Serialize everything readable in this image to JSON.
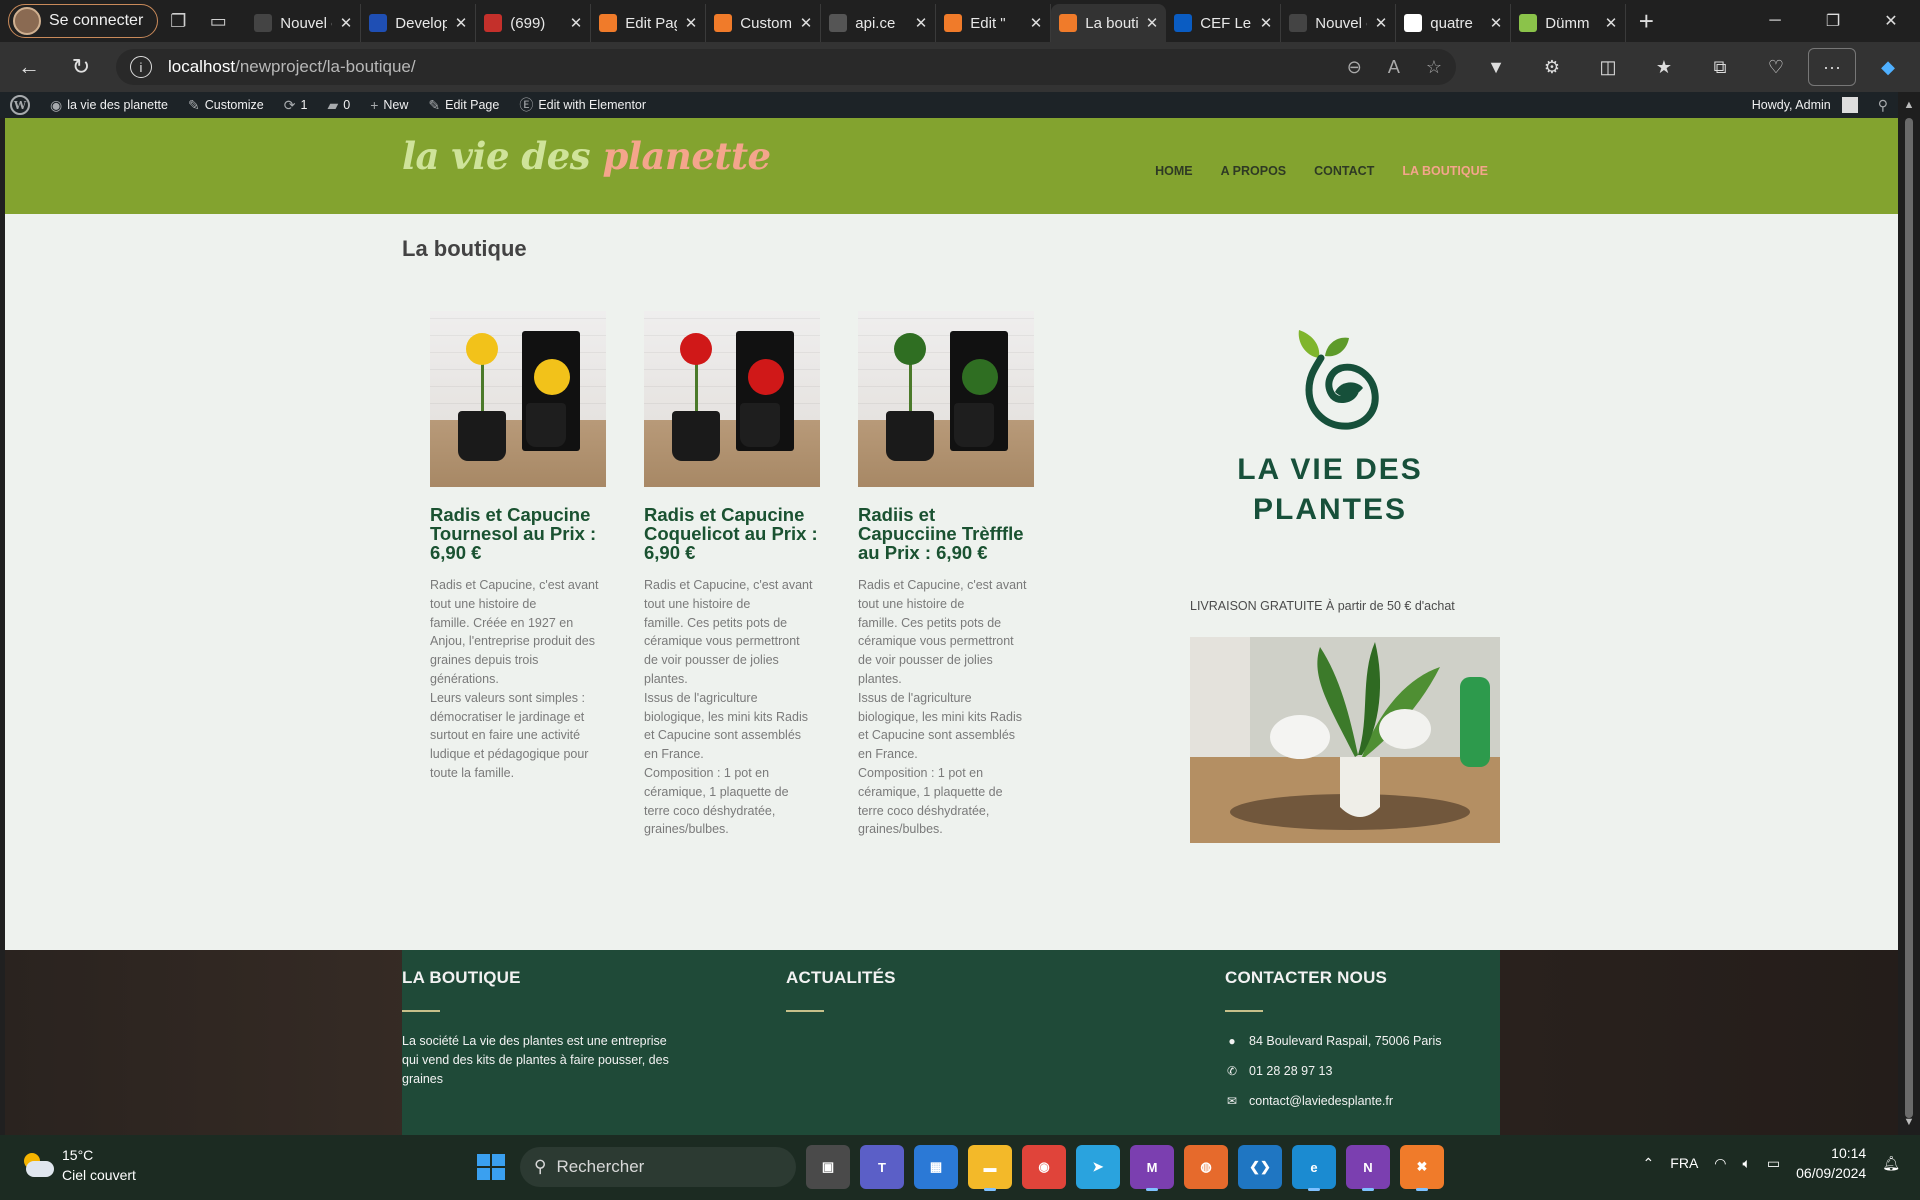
{
  "browser": {
    "profile_label": "Se connecter",
    "tabs": [
      {
        "title": "Nouvel onglet",
        "color": "#444444"
      },
      {
        "title": "Developer",
        "color": "#1f4fb4"
      },
      {
        "title": "(699)",
        "color": "#c4302b"
      },
      {
        "title": "Edit Page",
        "color": "#f07b2a"
      },
      {
        "title": "Customize",
        "color": "#f07b2a"
      },
      {
        "title": "api.ce",
        "color": "#555555"
      },
      {
        "title": "Edit \"",
        "color": "#f07b2a"
      },
      {
        "title": "La boutique",
        "color": "#f07b2a",
        "active": true
      },
      {
        "title": "CEF Le",
        "color": "#0a5cc2"
      },
      {
        "title": "Nouvel onglet",
        "color": "#444444"
      },
      {
        "title": "quatre",
        "color": "#ffffff"
      },
      {
        "title": "Dümm",
        "color": "#8bc34a"
      }
    ],
    "url_host": "localhost",
    "url_path": "/newproject/la-boutique/"
  },
  "wpbar": {
    "site": "la vie des planette",
    "customize": "Customize",
    "updates": "1",
    "comments": "0",
    "new": "New",
    "edit_page": "Edit Page",
    "elementor": "Edit with Elementor",
    "howdy": "Howdy, Admin"
  },
  "site": {
    "logo_part1": "la vie des",
    "logo_part2": "planette",
    "nav": [
      "HOME",
      "A PROPOS",
      "CONTACT",
      "LA BOUTIQUE"
    ],
    "page_title": "La boutique",
    "brand_line1": "LA VIE DES",
    "brand_line2": "PLANTES",
    "shipping": "LIVRAISON GRATUITE À partir de 50 € d'achat",
    "colors": {
      "header": "#83a32f",
      "accent": "#f4a58c",
      "product_title": "#1a5231",
      "footer": "#1f4a38"
    }
  },
  "products": [
    {
      "title": "Radis et Capucine Tournesol au Prix : 6,90 €",
      "flower_color": "#f2c21a",
      "desc": [
        "Radis et Capucine, c'est avant",
        "tout une histoire de",
        "famille. Créée en 1927 en",
        "Anjou, l'entreprise produit des",
        "graines depuis trois",
        "générations.",
        "Leurs valeurs sont simples :",
        "démocratiser le jardinage et",
        "surtout en faire une activité",
        "ludique et pédagogique pour",
        "toute la famille."
      ]
    },
    {
      "title": "Radis et Capucine Coquelicot au Prix : 6,90 €",
      "flower_color": "#d01818",
      "desc": [
        "Radis et Capucine, c'est avant",
        "tout une histoire de",
        "famille. Ces petits pots de",
        "céramique vous permettront",
        "de voir pousser de jolies",
        "plantes.",
        "Issus de l'agriculture",
        "biologique, les mini kits Radis",
        "et Capucine sont assemblés",
        "en France.",
        "Composition : 1 pot en",
        "céramique, 1 plaquette de",
        "terre coco déshydratée,",
        "graines/bulbes."
      ]
    },
    {
      "title": "Radiis et Capucciine Trèfffle au Prix : 6,90 €",
      "flower_color": "#2f6e22",
      "desc": [
        "Radis et Capucine, c'est avant",
        "tout une histoire de",
        "famille. Ces petits pots de",
        "céramique vous permettront",
        "de voir pousser de jolies",
        "plantes.",
        "Issus de l'agriculture",
        "biologique, les mini kits Radis",
        "et Capucine sont assemblés",
        "en France.",
        "Composition : 1 pot en",
        "céramique, 1 plaquette de",
        "terre coco déshydratée,",
        "graines/bulbes."
      ]
    }
  ],
  "footer": {
    "col1_title": "LA BOUTIQUE",
    "col1_text": "La société La vie des plantes est une entreprise qui vend des kits de plantes à faire pousser, des graines",
    "col2_title": "ACTUALITÉS",
    "col3_title": "CONTACTER NOUS",
    "address": "84 Boulevard Raspail, 75006 Paris",
    "phone": "01 28 28 97 13",
    "email": "contact@laviedesplante.fr"
  },
  "taskbar": {
    "temp": "15°C",
    "weather": "Ciel couvert",
    "search": "Rechercher",
    "lang": "FRA",
    "time": "10:14",
    "date": "06/09/2024"
  }
}
